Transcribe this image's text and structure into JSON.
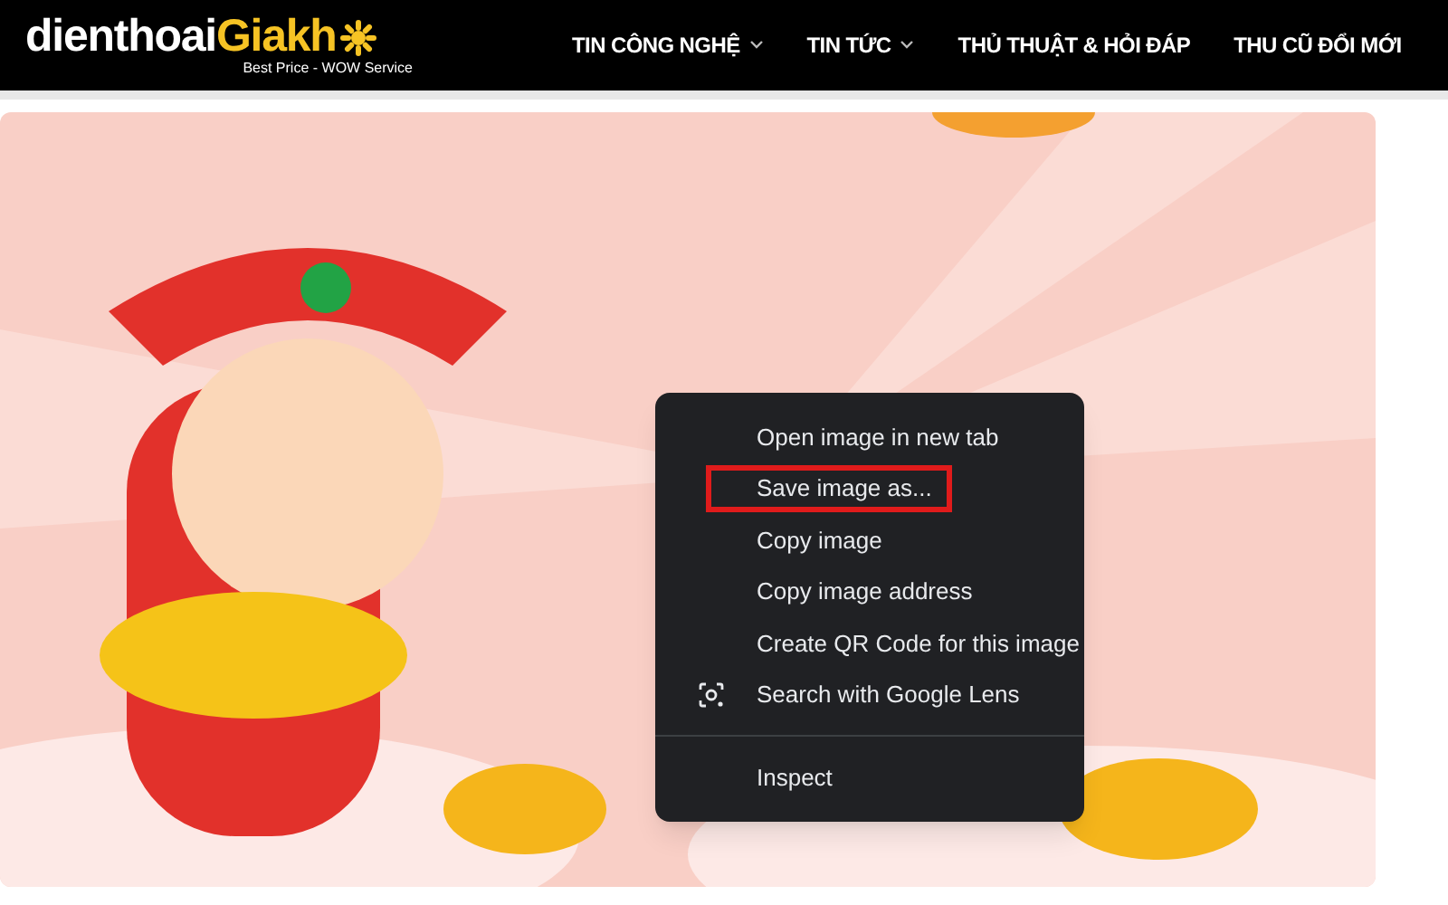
{
  "logo": {
    "part1": "dienthoai",
    "part2": "Giakh",
    "tagline": "Best Price - WOW Service"
  },
  "nav": [
    {
      "label": "TIN CÔNG NGHỆ",
      "dropdown": true
    },
    {
      "label": "TIN TỨC",
      "dropdown": true
    },
    {
      "label": "THỦ THUẬT & HỎI ĐÁP",
      "dropdown": false
    },
    {
      "label": "THU CŨ ĐỔI MỚI",
      "dropdown": false
    }
  ],
  "context_menu": {
    "groups": [
      [
        {
          "label": "Open image in new tab",
          "kind": "plain",
          "highlighted": false
        },
        {
          "label": "Save image as...",
          "kind": "plain",
          "highlighted": true
        },
        {
          "label": "Copy image",
          "kind": "plain",
          "highlighted": false
        },
        {
          "label": "Copy image address",
          "kind": "plain",
          "highlighted": false
        },
        {
          "label": "Create QR Code for this image",
          "kind": "plain",
          "highlighted": false
        },
        {
          "label": "Search with Google Lens",
          "kind": "lens",
          "highlighted": false
        }
      ],
      [
        {
          "label": "Inspect",
          "kind": "plain",
          "highlighted": false
        }
      ]
    ]
  }
}
